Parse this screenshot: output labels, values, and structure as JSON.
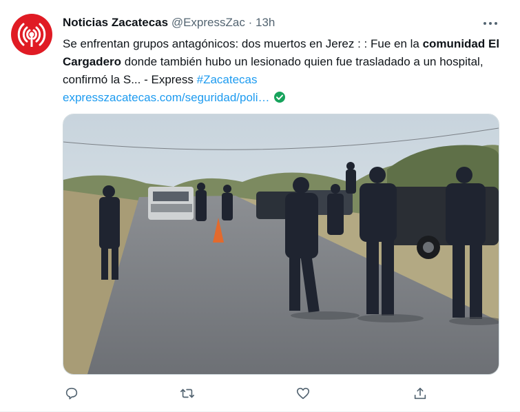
{
  "tweet": {
    "author_name": "Noticias Zacatecas",
    "handle": "@ExpressZac",
    "separator": "·",
    "time": "13h",
    "text_part1": "Se enfrentan grupos antagónicos: dos muertos en Jerez : : Fue en la ",
    "text_bold": "comunidad El Cargadero",
    "text_part2": " donde también hubo un lesionado quien fue trasladado a un hospital, confirmó la S... - Express ",
    "hashtag": "#Zacatecas",
    "link": "expresszacatecas.com/seguridad/poli…"
  },
  "colors": {
    "avatar_bg": "#e01b24",
    "link": "#1d9bf0",
    "verified": "#17a35c",
    "secondary_text": "#536471"
  },
  "icons": {
    "avatar": "broadcast-antenna-icon",
    "more": "more-horizontal-icon",
    "verified": "check-circle-icon",
    "reply": "reply-icon",
    "retweet": "retweet-icon",
    "like": "heart-icon",
    "share": "share-icon"
  },
  "media": {
    "type": "photo"
  }
}
